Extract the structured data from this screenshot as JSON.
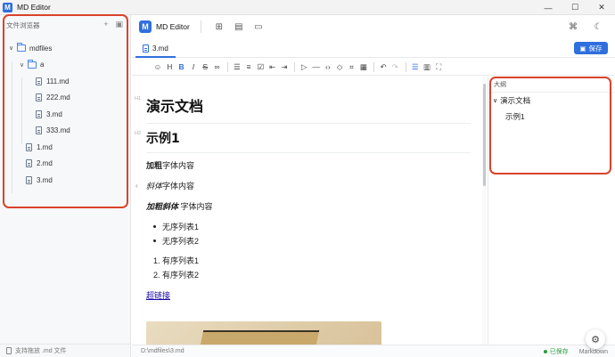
{
  "window": {
    "title": "MD Editor",
    "controls": [
      "—",
      "☐",
      "✕"
    ]
  },
  "sidebar": {
    "title": "文件浏览器",
    "tree": [
      {
        "label": "mdfiles",
        "type": "folder",
        "depth": 0,
        "expanded": true
      },
      {
        "label": "a",
        "type": "folder",
        "depth": 1,
        "expanded": true
      },
      {
        "label": "111.md",
        "type": "file",
        "depth": 2
      },
      {
        "label": "222.md",
        "type": "file",
        "depth": 2
      },
      {
        "label": "3.md",
        "type": "file",
        "depth": 2
      },
      {
        "label": "333.md",
        "type": "file",
        "depth": 2
      },
      {
        "label": "1.md",
        "type": "file",
        "depth": 1
      },
      {
        "label": "2.md",
        "type": "file",
        "depth": 1
      },
      {
        "label": "3.md",
        "type": "file",
        "depth": 1
      }
    ],
    "footer": "支持拖放 .md 文件"
  },
  "appbar": {
    "title": "MD Editor"
  },
  "tab": {
    "label": "3.md"
  },
  "save_button": {
    "label": "保存"
  },
  "editor": {
    "gutter": [
      "H1",
      "H2"
    ],
    "heading1": "演示文档",
    "heading2": "示例1",
    "bold_label": "加粗",
    "bold_rest": "字体内容",
    "italic_label": "斜体",
    "italic_rest": "字体内容",
    "bolditalic_label": "加粗斜体",
    "bolditalic_rest": " 字体内容",
    "unordered": [
      "无序列表1",
      "无序列表2"
    ],
    "ordered": [
      "1. 有序列表1",
      "2. 有序列表2"
    ],
    "link": "超链接"
  },
  "outline": {
    "title": "大纲",
    "items": [
      {
        "label": "演示文档",
        "level": 1
      },
      {
        "label": "示例1",
        "level": 2
      }
    ]
  },
  "statusbar": {
    "path": "D:\\mdfiles\\3.md",
    "saved": "已保存",
    "mode": "Markdown"
  }
}
